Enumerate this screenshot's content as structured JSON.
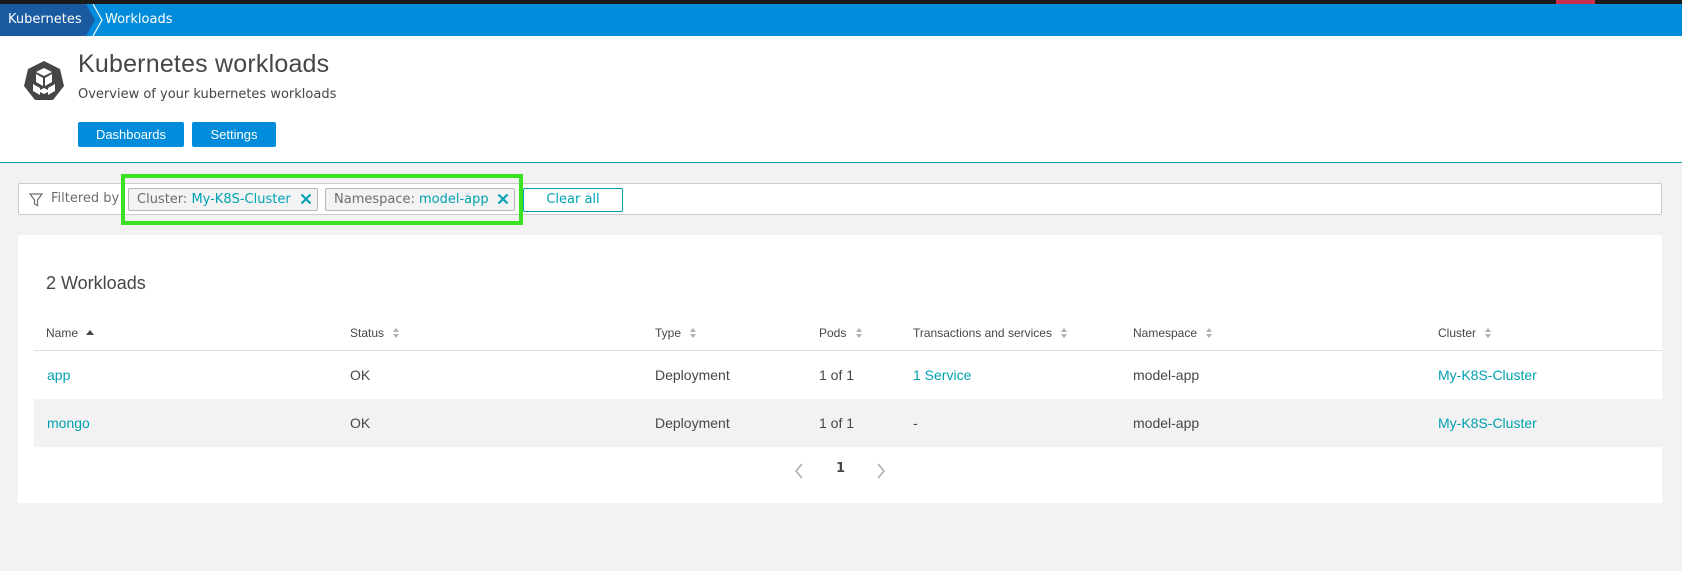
{
  "breadcrumb": {
    "root": "Kubernetes",
    "current": "Workloads"
  },
  "header": {
    "title": "Kubernetes workloads",
    "subtitle": "Overview of your kubernetes workloads",
    "buttons": [
      "Dashboards",
      "Settings"
    ]
  },
  "filter": {
    "label": "Filtered by",
    "chips": [
      {
        "key": "Cluster:",
        "value": "My-K8S-Cluster"
      },
      {
        "key": "Namespace:",
        "value": "model-app"
      }
    ],
    "clear_all": "Clear all"
  },
  "workloads": {
    "title": "2 Workloads",
    "columns": [
      "Name",
      "Status",
      "Type",
      "Pods",
      "Transactions and services",
      "Namespace",
      "Cluster"
    ],
    "rows": [
      {
        "name": "app",
        "status": "OK",
        "type": "Deployment",
        "pods": "1 of 1",
        "transactions": "1 Service",
        "namespace": "model-app",
        "cluster": "My-K8S-Cluster"
      },
      {
        "name": "mongo",
        "status": "OK",
        "type": "Deployment",
        "pods": "1 of 1",
        "transactions": "-",
        "namespace": "model-app",
        "cluster": "My-K8S-Cluster"
      }
    ]
  },
  "pagination": {
    "current_page": "1"
  },
  "colors": {
    "topbar": "#008cdb",
    "breadcrumb_root": "#1a5aa0",
    "accent_link": "#00a1b2",
    "highlight": "#3ae022"
  }
}
